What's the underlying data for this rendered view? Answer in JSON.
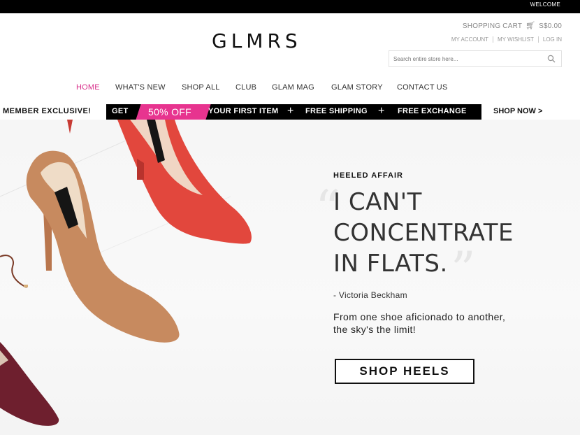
{
  "topbar": {
    "welcome": "WELCOME"
  },
  "brand": {
    "logo": "GLMRS"
  },
  "account": {
    "cart_label": "SHOPPING CART",
    "cart_total": "S$0.00",
    "links": [
      "MY ACCOUNT",
      "MY WISHLIST",
      "LOG IN"
    ],
    "search_placeholder": "Search entire store here..."
  },
  "nav": {
    "items": [
      "HOME",
      "WHAT'S NEW",
      "SHOP ALL",
      "CLUB",
      "GLAM MAG",
      "GLAM STORY",
      "CONTACT US"
    ],
    "active_index": 0
  },
  "promo": {
    "member": "MEMBER EXCLUSIVE!",
    "get": "GET",
    "discount": "50% OFF",
    "first_item": "YOUR FIRST ITEM",
    "plus": "+",
    "free_shipping": "FREE SHIPPING",
    "free_exchange": "FREE EXCHANGE",
    "shop_now": "SHOP NOW >"
  },
  "hero": {
    "kicker": "HEELED AFFAIR",
    "quote_lines": [
      "I CAN'T",
      "CONCENTRATE",
      "IN FLATS."
    ],
    "author": "- Victoria Beckham",
    "tagline_lines": [
      "From one shoe aficionado to another,",
      "the sky's the limit!"
    ],
    "cta": "SHOP HEELS"
  },
  "colors": {
    "accent_pink": "#e7348f",
    "bar_black": "#000000",
    "shoe_red": "#e2473d",
    "shoe_tan": "#c78a5f",
    "shoe_burgundy": "#6e1f2e"
  }
}
